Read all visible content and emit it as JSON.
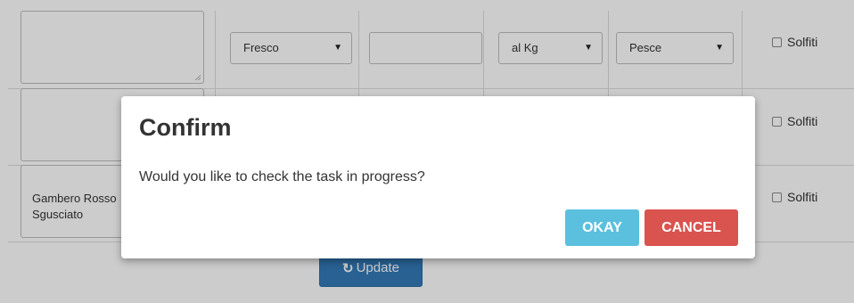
{
  "table": {
    "rows": [
      {
        "description": "",
        "state": "Fresco",
        "price": "",
        "unit": "al Kg",
        "category": "Pesce",
        "allergen_label": "Solfiti"
      },
      {
        "description": "",
        "allergen_label": "Solfiti"
      },
      {
        "description": "Gambero Rosso\nSgusciato",
        "allergen_label": "Solfiti"
      }
    ],
    "update_label": "Update"
  },
  "modal": {
    "title": "Confirm",
    "message": "Would you like to check the task in progress?",
    "okay_label": "OKAY",
    "cancel_label": "CANCEL",
    "okay_color": "#5bc0de",
    "cancel_color": "#d9534f"
  },
  "icons": {
    "caret": "caret-down-icon",
    "refresh": "refresh-icon"
  }
}
